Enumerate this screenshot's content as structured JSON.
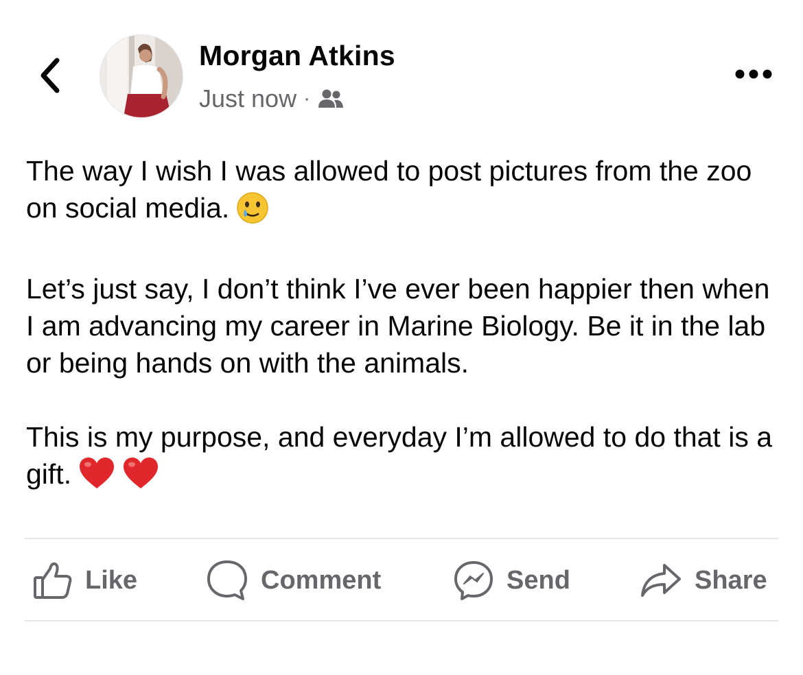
{
  "author": {
    "name": "Morgan Atkins",
    "timestamp": "Just now",
    "separator": "·",
    "audience_icon": "friends-icon"
  },
  "post": {
    "paragraphs": [
      {
        "text": "The way I wish I was allowed to post pictures from the zoo on social media.",
        "emoji": "smiling-face-with-tear-icon"
      },
      {
        "text": "Let’s just say, I don’t think I’ve ever been happier then when I am advancing my career in Marine Biology. Be it in the lab or being hands on with the animals."
      },
      {
        "text": "This is my purpose, and everyday I’m allowed to do that is a gift.",
        "emoji": "red-heart-icon x2"
      }
    ]
  },
  "actions": {
    "like": "Like",
    "comment": "Comment",
    "send": "Send",
    "share": "Share"
  },
  "colors": {
    "text_primary": "#050505",
    "text_secondary": "#65676b",
    "divider": "#e4e6eb",
    "heart": "#e0272c",
    "emoji_face": "#f7c531"
  }
}
